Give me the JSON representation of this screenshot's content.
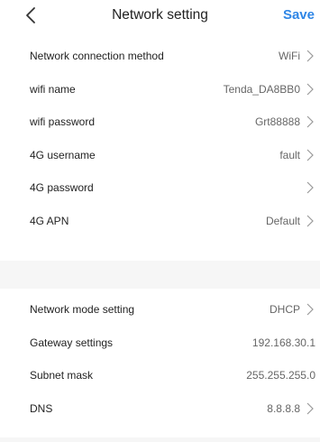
{
  "header": {
    "title": "Network setting",
    "save_label": "Save",
    "back_icon": "chevron-left-icon",
    "accent_color": "#2f86e6"
  },
  "section1": {
    "rows": [
      {
        "label": "Network connection method",
        "value": "WiFi",
        "chevron": true
      },
      {
        "label": "wifi name",
        "value": "Tenda_DA8BB0",
        "chevron": true
      },
      {
        "label": "wifi password",
        "value": "Grt88888",
        "chevron": true
      },
      {
        "label": "4G username",
        "value": "fault",
        "chevron": true
      },
      {
        "label": "4G password",
        "value": "",
        "chevron": true
      },
      {
        "label": "4G APN",
        "value": "Default",
        "chevron": true
      }
    ]
  },
  "section2": {
    "rows": [
      {
        "label": "Network mode setting",
        "value": "DHCP",
        "chevron": true
      },
      {
        "label": "Gateway settings",
        "value": "192.168.30.1",
        "chevron": false
      },
      {
        "label": "Subnet mask",
        "value": "255.255.255.0",
        "chevron": false
      },
      {
        "label": "DNS",
        "value": "8.8.8.8",
        "chevron": true
      }
    ]
  },
  "icons": {
    "row_chevron": "chevron-right-icon"
  }
}
